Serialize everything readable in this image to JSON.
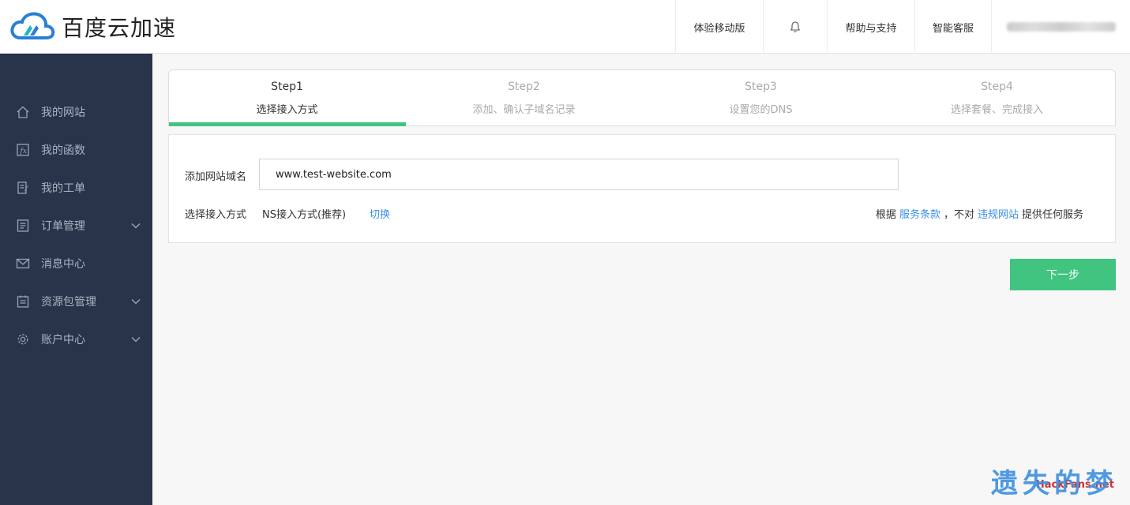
{
  "header": {
    "logo_text": "百度云加速",
    "nav": [
      {
        "label": "体验移动版"
      },
      {
        "label": ""
      },
      {
        "label": "帮助与支持"
      },
      {
        "label": "智能客服"
      }
    ]
  },
  "sidebar": {
    "items": [
      {
        "label": "我的网站",
        "icon": "home-icon"
      },
      {
        "label": "我的函数",
        "icon": "function-icon"
      },
      {
        "label": "我的工单",
        "icon": "ticket-icon"
      },
      {
        "label": "订单管理",
        "icon": "order-icon",
        "expandable": true
      },
      {
        "label": "消息中心",
        "icon": "mail-icon"
      },
      {
        "label": "资源包管理",
        "icon": "package-icon",
        "expandable": true
      },
      {
        "label": "账户中心",
        "icon": "gear-icon",
        "expandable": true
      }
    ]
  },
  "steps": [
    {
      "step": "Step1",
      "label": "选择接入方式",
      "active": true
    },
    {
      "step": "Step2",
      "label": "添加、确认子域名记录",
      "active": false
    },
    {
      "step": "Step3",
      "label": "设置您的DNS",
      "active": false
    },
    {
      "step": "Step4",
      "label": "选择套餐、完成接入",
      "active": false
    }
  ],
  "form": {
    "domain_label": "添加网站域名",
    "domain_value": "www.test-website.com",
    "access_label": "选择接入方式",
    "access_value": "NS接入方式(推荐)",
    "switch_link": "切换",
    "notice_prefix": "根据",
    "terms_link": "服务条款",
    "notice_middle": "，不对",
    "illegal_link": "违规网站",
    "notice_suffix": "提供任何服务"
  },
  "next_button": "下一步",
  "watermark": "遗失的梦",
  "watermark_back": "HackFans.net",
  "colors": {
    "accent_green": "#41c480",
    "sidebar_bg": "#273449",
    "link_blue": "#3a8ee6"
  }
}
